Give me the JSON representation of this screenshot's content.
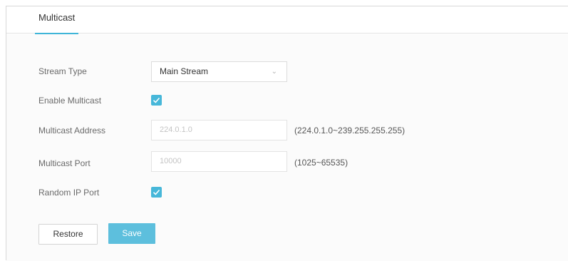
{
  "tabs": [
    {
      "label": "Multicast",
      "active": true
    }
  ],
  "form": {
    "stream_type": {
      "label": "Stream Type",
      "value": "Main Stream",
      "icon": "chevron-down-icon"
    },
    "enable_multicast": {
      "label": "Enable Multicast",
      "checked": true
    },
    "multicast_address": {
      "label": "Multicast Address",
      "value": "224.0.1.0",
      "hint": "(224.0.1.0~239.255.255.255)"
    },
    "multicast_port": {
      "label": "Multicast Port",
      "value": "10000",
      "hint": "(1025~65535)"
    },
    "random_ip_port": {
      "label": "Random IP Port",
      "checked": true
    }
  },
  "buttons": {
    "restore": "Restore",
    "save": "Save"
  },
  "colors": {
    "accent": "#47b7d9",
    "save_button": "#5dbfdd"
  }
}
